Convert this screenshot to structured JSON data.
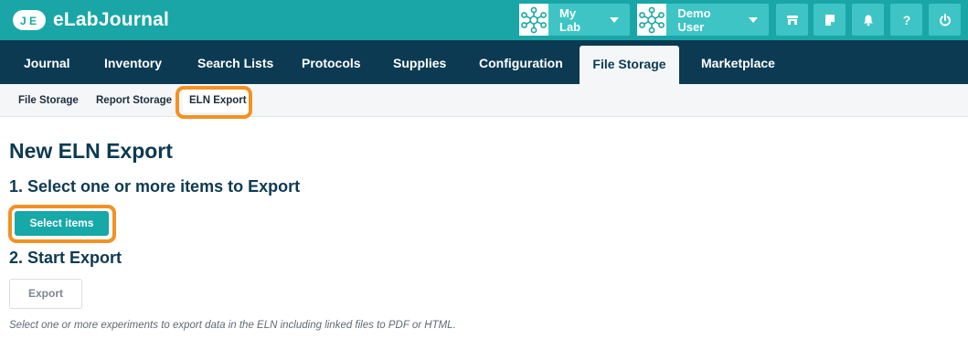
{
  "app": {
    "name": "eLabJournal",
    "logo_letters": "J E"
  },
  "colors": {
    "teal": "#1aa6a6",
    "navy": "#0c3a52",
    "highlight": "#f39123"
  },
  "header": {
    "org_dropdown": {
      "label": "My Lab",
      "icon": "network-icon"
    },
    "user_dropdown": {
      "label": "Demo User",
      "icon": "network-icon"
    },
    "buttons": [
      {
        "icon": "store-icon"
      },
      {
        "icon": "note-icon"
      },
      {
        "icon": "bell-icon"
      },
      {
        "icon": "question-icon",
        "glyph": "?"
      },
      {
        "icon": "power-icon"
      }
    ]
  },
  "nav": {
    "items": [
      "Journal",
      "Inventory",
      "Search Lists",
      "Protocols",
      "Supplies",
      "Configuration",
      "File Storage",
      "Marketplace"
    ],
    "active": "File Storage"
  },
  "subnav": {
    "items": [
      "File Storage",
      "Report Storage",
      "ELN Export"
    ],
    "active": "ELN Export"
  },
  "main": {
    "title": "New ELN Export",
    "step1_title": "1. Select one or more items to Export",
    "select_button": "Select items",
    "step2_title": "2. Start Export",
    "export_button": "Export",
    "help_text": "Select one or more experiments to export data in the ELN including linked files to PDF or HTML."
  }
}
